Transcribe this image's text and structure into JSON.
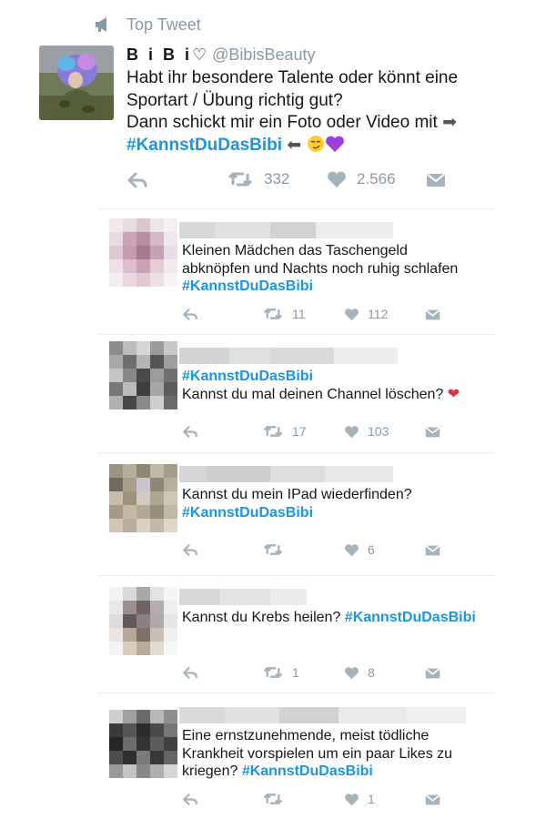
{
  "header": {
    "label": "Top Tweet",
    "icon": "megaphone-icon"
  },
  "main_tweet": {
    "name": "B i B i",
    "name_heart": "♡",
    "handle": "@BibisBeauty",
    "lines": [
      "Habt ihr besondere Talente oder könnt eine",
      "Sportart / Übung richtig gut?",
      "Dann schickt mir ein Foto oder Video mit "
    ],
    "arrow_right": "➡",
    "hashtag": "#KannstDuDasBibi",
    "arrow_left": " ⬅ ",
    "emoji_1": "😏",
    "emoji_2": "💜",
    "retweets": "332",
    "likes": "2.566"
  },
  "replies": [
    {
      "lines": [
        "Kleinen Mädchen das Taschengeld",
        "abknöpfen und Nachts noch ruhig schlafen"
      ],
      "hashtag": "#KannstDuDasBibi",
      "retweets": "11",
      "likes": "112"
    },
    {
      "hashtag": "#KannstDuDasBibi",
      "lines": [
        "Kannst du mal deinen Channel löschen? "
      ],
      "emoji": "❤",
      "retweets": "17",
      "likes": "103"
    },
    {
      "lines": [
        "Kannst du mein IPad wiederfinden?"
      ],
      "hashtag": "#KannstDuDasBibi",
      "retweets": "",
      "likes": "6"
    },
    {
      "lines": [
        "Kannst du Krebs heilen? "
      ],
      "hashtag": "#KannstDuDasBibi",
      "retweets": "1",
      "likes": "8"
    },
    {
      "lines": [
        "Eine ernstzunehmende, meist tödliche",
        "Krankheit vorspielen um ein paar Likes zu",
        "kriegen? "
      ],
      "hashtag": "#KannstDuDasBibi",
      "retweets": "",
      "likes": "1"
    }
  ],
  "colors": {
    "accent": "#1b95e0",
    "muted": "#8899a6",
    "divider": "#e6ecf0",
    "text": "#14171a"
  }
}
